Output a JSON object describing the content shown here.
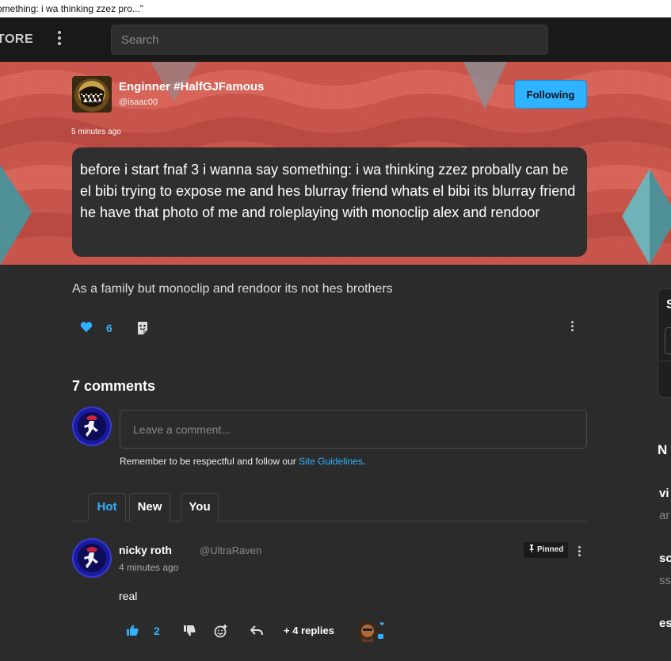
{
  "tab_title": "omething: i wa thinking zzez pro...\"",
  "nav": {
    "store_label": "TORE",
    "search_placeholder": "Search"
  },
  "post": {
    "author_name": "Enginner #HalfGJFamous",
    "author_handle": "@isaac00",
    "follow_label": "Following",
    "time": "5 minutes ago",
    "body": "before i start fnaf 3 i wanna say something: i wa thinking zzez probally can be el bibi trying to expose me and hes blurray friend whats el bibi its blurray friend he have that photo of me and roleplaying with monoclip alex and rendoor",
    "extra": "As a family but monoclip and rendoor its not hes brothers",
    "likes": "6"
  },
  "comments": {
    "title": "7 comments",
    "input_placeholder": "Leave a comment...",
    "guidelines_prefix": "Remember to be respectful and follow our ",
    "guidelines_link": "Site Guidelines",
    "guidelines_suffix": ".",
    "tabs": [
      "Hot",
      "New",
      "You"
    ],
    "items": [
      {
        "name": "nicky roth",
        "handle": "@UltraRaven",
        "time": "4 minutes ago",
        "pinned_label": "Pinned",
        "text": "real",
        "likes": "2",
        "replies_label": "+ 4 replies"
      }
    ]
  },
  "sidebar_peek": {
    "card_letter": "S",
    "heading_letter": "N",
    "lines": [
      "vi",
      "ar",
      "sc",
      "ss",
      "es"
    ]
  },
  "colors": {
    "accent": "#2fb2ff",
    "background": "#2b2b2b",
    "banner": "#c8544a"
  }
}
